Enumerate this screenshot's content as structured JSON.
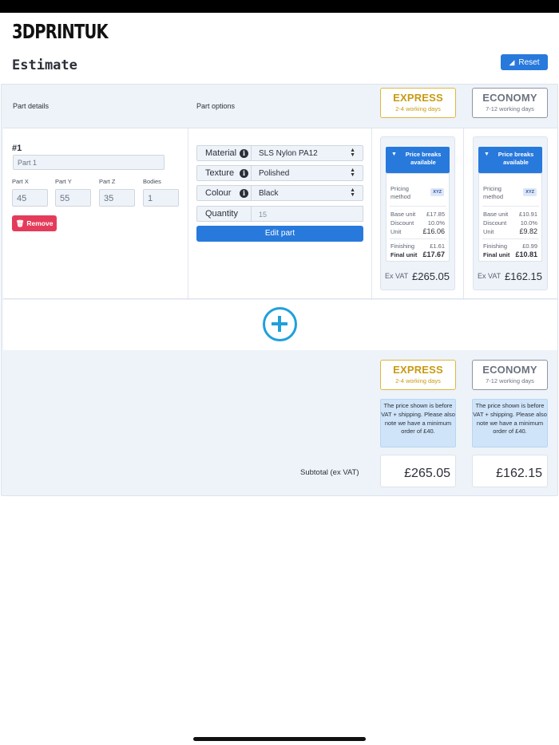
{
  "app": {
    "brand": "3DPRINTUK"
  },
  "header": {
    "title": "Estimate",
    "reset_label": "Reset"
  },
  "columns": {
    "part_details": "Part details",
    "part_options": "Part options",
    "express": {
      "name": "EXPRESS",
      "days": "2-4 working days"
    },
    "economy": {
      "name": "ECONOMY",
      "days": "7-12 working days"
    }
  },
  "part": {
    "number": "#1",
    "name_placeholder": "Part 1",
    "dims": {
      "x_label": "Part X",
      "y_label": "Part Y",
      "z_label": "Part Z",
      "bodies_label": "Bodies",
      "x": "45",
      "y": "55",
      "z": "35",
      "bodies": "1"
    },
    "remove_label": "Remove",
    "options": {
      "material_label": "Material",
      "material_value": "SLS Nylon PA12",
      "texture_label": "Texture",
      "texture_value": "Polished",
      "colour_label": "Colour",
      "colour_value": "Black",
      "quantity_label": "Quantity",
      "quantity_value": "15"
    },
    "edit_label": "Edit part"
  },
  "pricing": {
    "header": "Price breaks available",
    "pricing_method_label": "Pricing method",
    "badge": "XYZ",
    "base_unit_label": "Base unit",
    "discount_label": "Discount",
    "unit_label": "Unit",
    "finishing_label": "Finishing",
    "final_unit_label": "Final unit",
    "exvat_label": "Ex VAT",
    "express": {
      "base_unit": "£17.85",
      "discount": "10.0%",
      "unit": "£16.06",
      "finishing": "£1.61",
      "final_unit": "£17.67",
      "total": "£265.05"
    },
    "economy": {
      "base_unit": "£10.91",
      "discount": "10.0%",
      "unit": "£9.82",
      "finishing": "£0.99",
      "final_unit": "£10.81",
      "total": "£162.15"
    }
  },
  "summary": {
    "note": "The price shown is before VAT + shipping. Please also note we have a minimum order of £40.",
    "subtotal_label": "Subtotal (ex VAT)",
    "express_subtotal": "£265.05",
    "economy_subtotal": "£162.15"
  }
}
